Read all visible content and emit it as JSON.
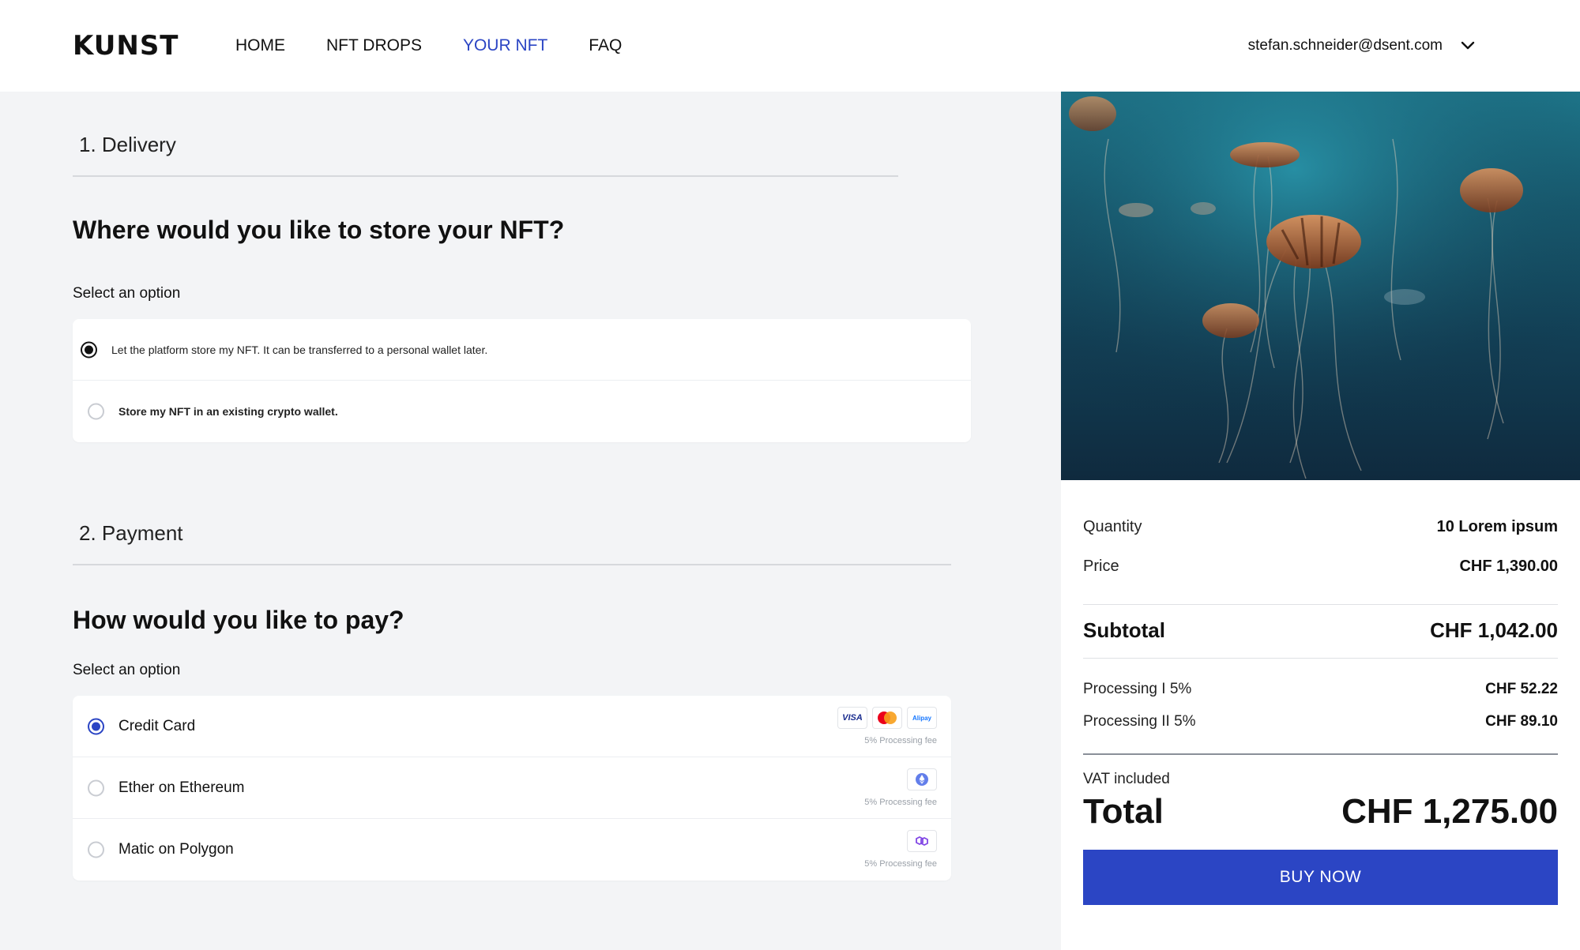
{
  "header": {
    "logo": "KUNST",
    "nav": [
      {
        "label": "HOME",
        "active": false
      },
      {
        "label": "NFT DROPS",
        "active": false
      },
      {
        "label": "YOUR NFT",
        "active": true
      },
      {
        "label": "FAQ",
        "active": false
      }
    ],
    "user_email": "stefan.schneider@dsent.com",
    "user_menu_icon": "chevron-down-icon"
  },
  "delivery": {
    "section_title": "1. Delivery",
    "question": "Where would you like to store your NFT?",
    "select_label": "Select an option",
    "options": [
      {
        "label": "Let the platform store my NFT. It can be transferred to a personal wallet later.",
        "selected": true
      },
      {
        "label": "Store my NFT in an existing crypto wallet.",
        "selected": false
      }
    ]
  },
  "payment": {
    "section_title": "2. Payment",
    "question": "How would you like to pay?",
    "select_label": "Select an option",
    "options": [
      {
        "label": "Credit Card",
        "selected": true,
        "fee": "5% Processing fee",
        "icons": [
          "VISA",
          "mastercard-icon",
          "Alipay"
        ]
      },
      {
        "label": "Ether on Ethereum",
        "selected": false,
        "fee": "5% Processing fee",
        "icons": [
          "ethereum-icon"
        ]
      },
      {
        "label": "Matic on Polygon",
        "selected": false,
        "fee": "5% Processing fee",
        "icons": [
          "polygon-icon"
        ]
      }
    ]
  },
  "summary": {
    "quantity_label": "Quantity",
    "quantity_value": "10 Lorem ipsum",
    "price_label": "Price",
    "price_value": "CHF 1,390.00",
    "subtotal_label": "Subtotal",
    "subtotal_value": "CHF 1,042.00",
    "processing1_label": "Processing I 5%",
    "processing1_value": "CHF 52.22",
    "processing2_label": "Processing II 5%",
    "processing2_value": "CHF 89.10",
    "vat_label": "VAT included",
    "total_label": "Total",
    "total_value": "CHF 1,275.00",
    "buy_label": "BUY NOW"
  },
  "colors": {
    "accent": "#2b45c4",
    "background": "#f3f4f6",
    "panel": "#ffffff"
  }
}
